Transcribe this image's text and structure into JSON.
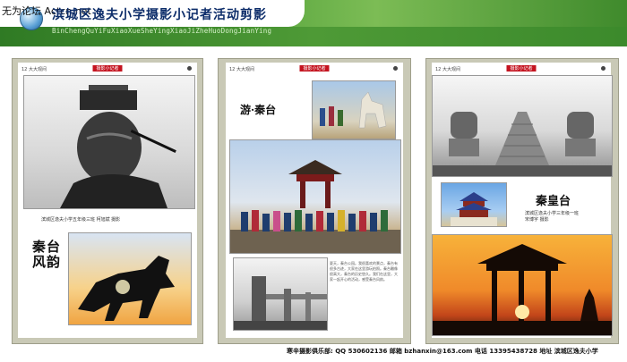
{
  "site_tag": "无为论坛 Actcn.net",
  "title": "滨城区逸夫小学摄影小记者活动剪影",
  "subtitle": "BinChengQuYiFuXiaoXueSheYingXiaoJiZheHuoDongJianYing",
  "panels": [
    {
      "header_left": "12 大大观间",
      "header_tag": "摄影小记者",
      "caption": "滨城区逸夫小学五年级三班    柯旭斌   摄影",
      "vertical_title": [
        "秦",
        "台",
        "风",
        "韵"
      ]
    },
    {
      "header_left": "12 大大观间",
      "header_tag": "摄影小记者",
      "title": "游·秦台",
      "essay": "夏天，秦台公园。我很喜欢的景点，秦台有很多古迹，大家在这里游玩拍照。秦台雕像很高大，秦台的历史悠久。我们在这里，大家一起开心的活动，感受秦台风韵。"
    },
    {
      "header_left": "12 大大观间",
      "header_tag": "摄影小记者",
      "title": "秦皇台",
      "caption": "滨城区逸夫小学三年级一班\n宋博宇   摄影"
    }
  ],
  "footer": "寒辛摄影俱乐部: QQ  530602136    邮箱  bzhanxin@163.com    电话  13395438728    地址   滨城区逸夫小学"
}
